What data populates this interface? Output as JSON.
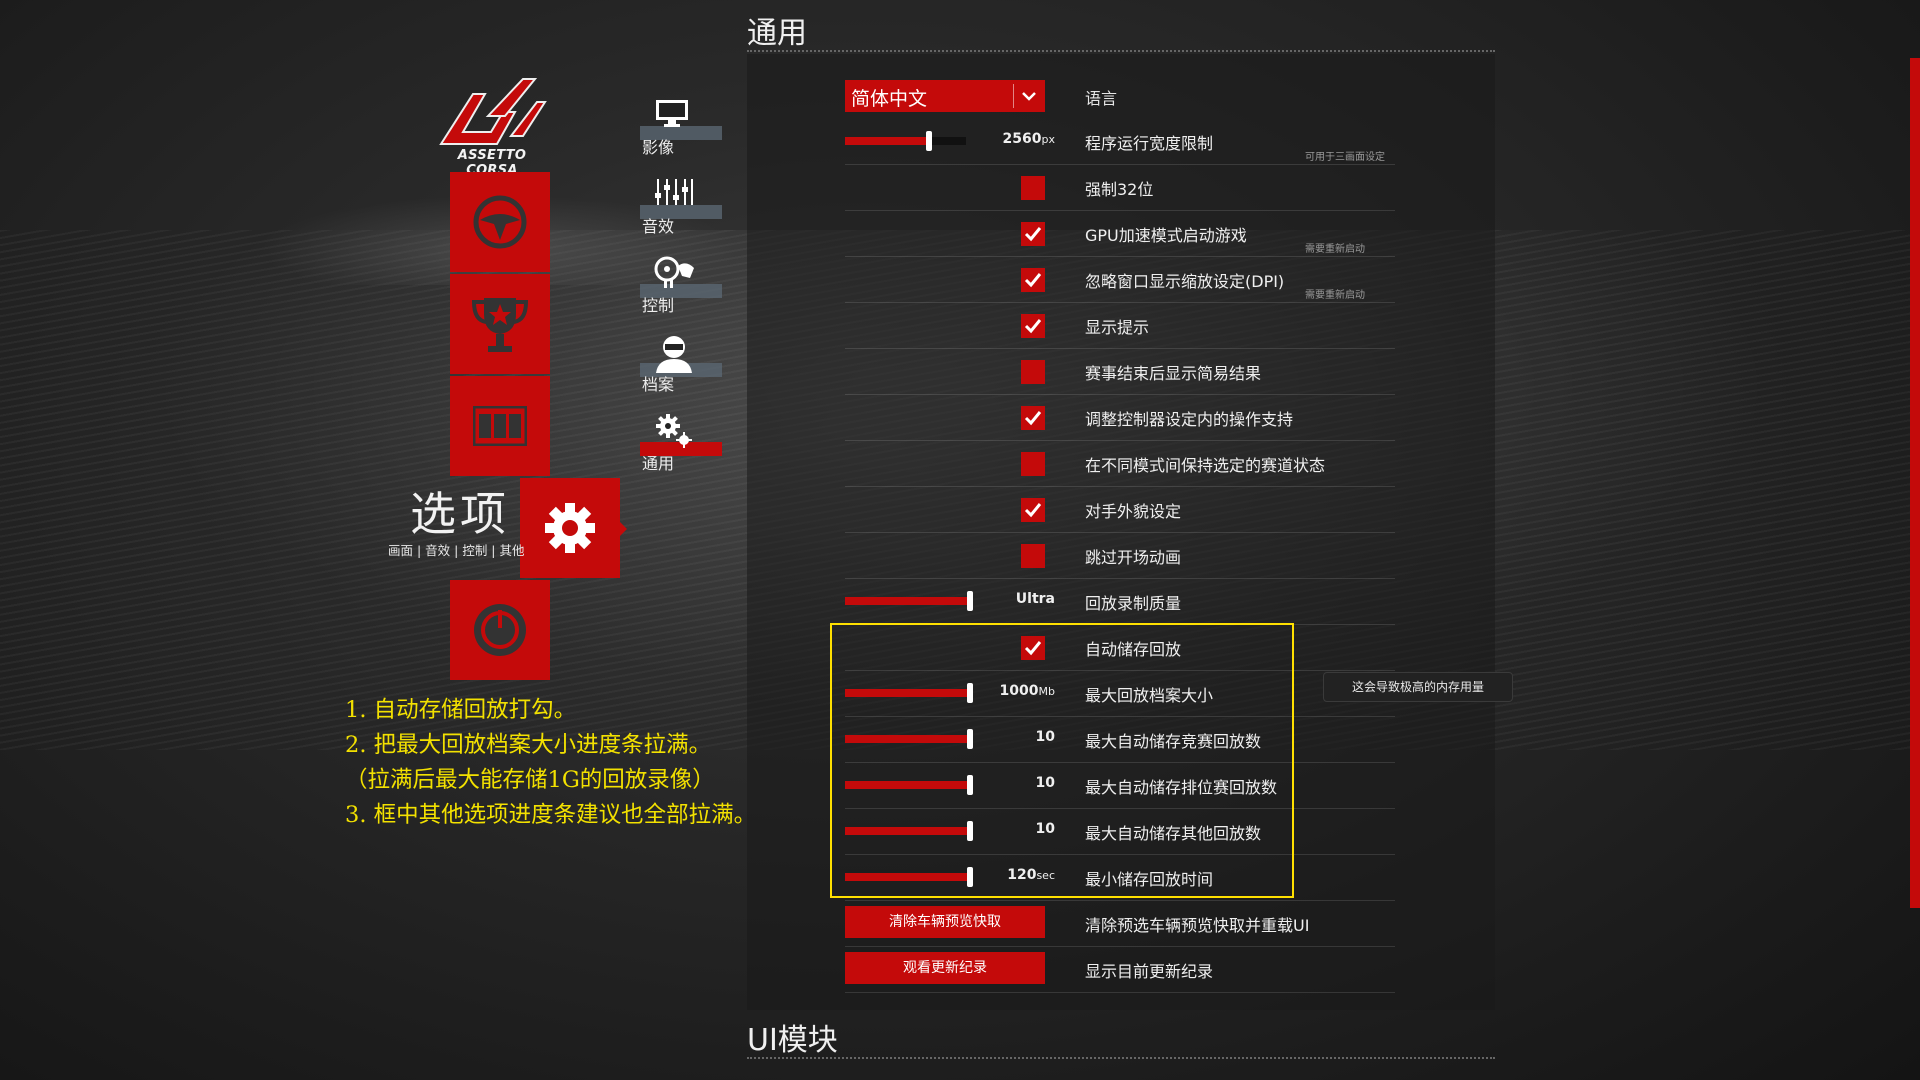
{
  "colors": {
    "accent": "#c40a0a",
    "highlight": "#ffe000",
    "annotation": "#f3e100"
  },
  "logo": {
    "text": "ASSETTO CORSA"
  },
  "main_tiles": [
    {
      "icon": "steering-wheel-icon"
    },
    {
      "icon": "trophy-icon"
    },
    {
      "icon": "film-strip-icon"
    },
    {
      "icon": "gear-icon"
    },
    {
      "icon": "power-icon"
    }
  ],
  "options": {
    "title": "选项",
    "subtitle": "画面 | 音效 | 控制 | 其他"
  },
  "submenu": [
    {
      "label": "影像",
      "icon": "monitor-icon"
    },
    {
      "label": "音效",
      "icon": "equalizer-icon"
    },
    {
      "label": "控制",
      "icon": "controller-icon"
    },
    {
      "label": "档案",
      "icon": "driver-profile-icon"
    },
    {
      "label": "通用",
      "icon": "gears-icon",
      "active": true
    }
  ],
  "section": {
    "title": "通用",
    "next_title": "UI模块"
  },
  "language": {
    "value": "简体中文",
    "label": "语言"
  },
  "rows": [
    {
      "type": "slider",
      "label": "程序运行宽度限制",
      "value": "2560",
      "unit": "px",
      "fraction": 0.66,
      "note": "可用于三画面设定"
    },
    {
      "type": "checkbox",
      "label": "强制32位",
      "checked": false
    },
    {
      "type": "checkbox",
      "label": "GPU加速模式启动游戏",
      "checked": true,
      "note": "需要重新启动"
    },
    {
      "type": "checkbox",
      "label": "忽略窗口显示缩放设定(DPI)",
      "checked": true,
      "note": "需要重新启动"
    },
    {
      "type": "checkbox",
      "label": "显示提示",
      "checked": true
    },
    {
      "type": "checkbox",
      "label": "赛事结束后显示简易结果",
      "checked": false
    },
    {
      "type": "checkbox",
      "label": "调整控制器设定内的操作支持",
      "checked": true
    },
    {
      "type": "checkbox",
      "label": "在不同模式间保持选定的赛道状态",
      "checked": false
    },
    {
      "type": "checkbox",
      "label": "对手外貌设定",
      "checked": true
    },
    {
      "type": "checkbox",
      "label": "跳过开场动画",
      "checked": false
    },
    {
      "type": "slider",
      "label": "回放录制质量",
      "value": "Ultra",
      "unit": "",
      "fraction": 1.0
    },
    {
      "type": "checkbox",
      "label": "自动储存回放",
      "checked": true
    },
    {
      "type": "slider",
      "label": "最大回放档案大小",
      "value": "1000",
      "unit": "Mb",
      "fraction": 1.0
    },
    {
      "type": "slider",
      "label": "最大自动储存竞赛回放数",
      "value": "10",
      "unit": "",
      "fraction": 1.0
    },
    {
      "type": "slider",
      "label": "最大自动储存排位赛回放数",
      "value": "10",
      "unit": "",
      "fraction": 1.0
    },
    {
      "type": "slider",
      "label": "最大自动储存其他回放数",
      "value": "10",
      "unit": "",
      "fraction": 1.0
    },
    {
      "type": "slider",
      "label": "最小储存回放时间",
      "value": "120",
      "unit": "sec",
      "fraction": 1.0
    },
    {
      "type": "button",
      "label": "清除预选车辆预览快取并重载UI",
      "button": "清除车辆预览快取"
    },
    {
      "type": "button",
      "label": "显示目前更新纪录",
      "button": "观看更新纪录"
    }
  ],
  "tooltip": "这会导致极高的内存用量",
  "annotations": [
    "1. 自动存储回放打勾。",
    "2. 把最大回放档案大小进度条拉满。",
    "（拉满后最大能存储1G的回放录像）",
    "3. 框中其他选项进度条建议也全部拉满。"
  ]
}
